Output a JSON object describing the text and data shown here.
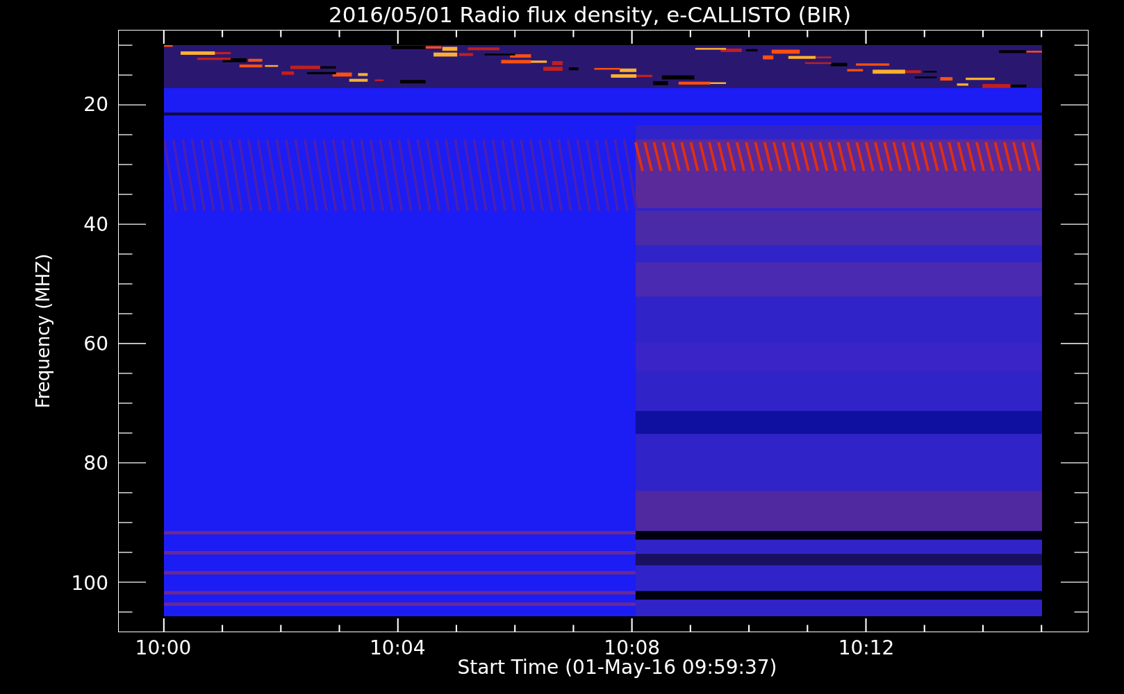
{
  "title": "2016/05/01  Radio flux density, e-CALLISTO (BIR)",
  "y_axis": {
    "label": "Frequency (MHZ)",
    "ticks": [
      "20",
      "40",
      "60",
      "80",
      "100"
    ]
  },
  "x_axis": {
    "label": "Start Time (01-May-16 09:59:37)",
    "ticks": [
      "10:00",
      "10:04",
      "10:08",
      "10:12"
    ]
  }
}
